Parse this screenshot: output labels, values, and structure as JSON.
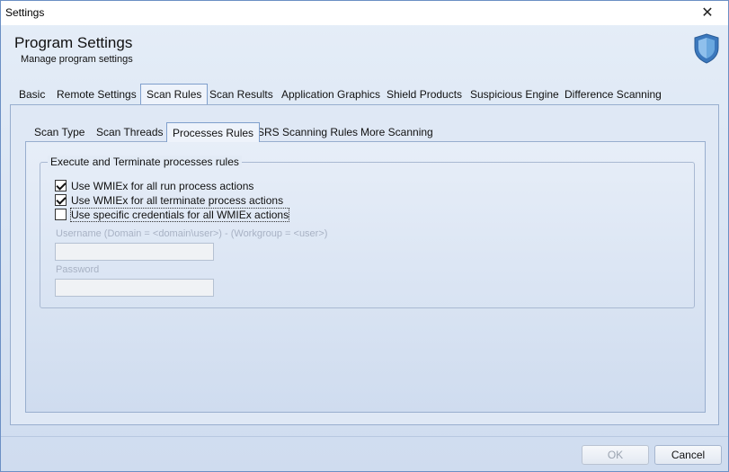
{
  "window": {
    "title": "Settings",
    "close_glyph": "✕"
  },
  "header": {
    "title": "Program Settings",
    "subtitle": "Manage program settings",
    "icon": "shield-icon",
    "accent": "#4a86c5"
  },
  "main_tabs": [
    {
      "label": "Basic",
      "active": false
    },
    {
      "label": "Remote Settings",
      "active": false
    },
    {
      "label": "Scan Rules",
      "active": true
    },
    {
      "label": "Scan Results",
      "active": false
    },
    {
      "label": "Application Graphics",
      "active": false
    },
    {
      "label": "Shield Products",
      "active": false
    },
    {
      "label": "Suspicious Engine",
      "active": false
    },
    {
      "label": "Difference Scanning",
      "active": false
    }
  ],
  "sub_tabs": [
    {
      "label": "Scan Type",
      "active": false
    },
    {
      "label": "Scan Threads",
      "active": false
    },
    {
      "label": "Processes Rules",
      "active": true
    },
    {
      "label": "SRS Scanning Rules",
      "active": false
    },
    {
      "label": "More Scanning",
      "active": false
    }
  ],
  "group": {
    "legend": "Execute and Terminate processes rules",
    "options": [
      {
        "label": "Use WMIEx for all run process actions",
        "checked": true
      },
      {
        "label": "Use WMIEx for all terminate process actions",
        "checked": true
      },
      {
        "label": "Use specific credentials for all WMIEx actions",
        "checked": false
      }
    ],
    "username_label": "Username (Domain = <domain\\user>) - (Workgroup = <user>)",
    "username_value": "",
    "password_label": "Password",
    "password_value": ""
  },
  "footer": {
    "ok_label": "OK",
    "cancel_label": "Cancel",
    "ok_enabled": false
  }
}
